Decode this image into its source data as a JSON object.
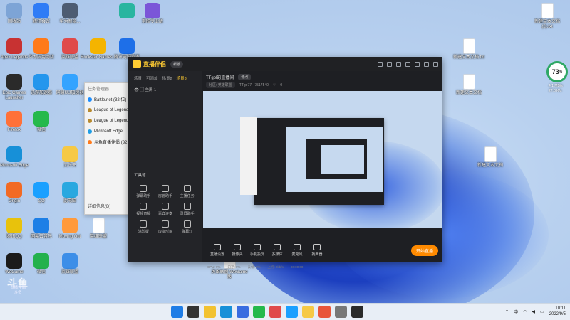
{
  "desktop": {
    "icons": [
      {
        "label": "回收站",
        "color": "#7da4d6",
        "glyph": "recycle-bin"
      },
      {
        "label": "腾讯会议",
        "color": "#2f7cf6",
        "glyph": "meeting"
      },
      {
        "label": "华为智能...",
        "color": "#4d5c72",
        "glyph": "tool"
      },
      {
        "label": "",
        "color": "#29b5a0",
        "glyph": "cloud"
      },
      {
        "label": "剪映专业版",
        "color": "#7b56d8",
        "glyph": "video"
      },
      {
        "label": "Apex Legends",
        "color": "#c83232",
        "glyph": "apex"
      },
      {
        "label": "华为应用商店",
        "color": "#ff7a1a",
        "glyph": "store"
      },
      {
        "label": "英雄联盟",
        "color": "#e04a4a",
        "glyph": "game"
      },
      {
        "label": "Rockstar Games...",
        "color": "#f5b400",
        "glyph": "rockstar"
      },
      {
        "label": "腾讯电脑管家",
        "color": "#1e6fe8",
        "glyph": "shield"
      },
      {
        "label": "Epic Games Launcher",
        "color": "#2a2a2a",
        "glyph": "epic"
      },
      {
        "label": "迅游加速器",
        "color": "#2496ed",
        "glyph": "speed"
      },
      {
        "label": "网易UU加速器",
        "color": "#33a3ff",
        "glyph": "speed"
      },
      {
        "label": "Firefox",
        "color": "#ff7139",
        "glyph": "firefox"
      },
      {
        "label": "微信",
        "color": "#25b94b",
        "glyph": "wechat"
      },
      {
        "label": "Microsoft Edge",
        "color": "#1790d8",
        "glyph": "edge"
      },
      {
        "label": "文件夹",
        "color": "#f6c945",
        "glyph": "folder"
      },
      {
        "label": "Origin",
        "color": "#f26a24",
        "glyph": "origin"
      },
      {
        "label": "QQ",
        "color": "#1aa0ff",
        "glyph": "qq"
      },
      {
        "label": "此电脑",
        "color": "#29a8e0",
        "glyph": "pc"
      },
      {
        "label": "腾讯QQ",
        "color": "#e8c20c",
        "glyph": "qq"
      },
      {
        "label": "网易云音乐",
        "color": "#1d7fe6",
        "glyph": "music"
      },
      {
        "label": "Moving Out",
        "color": "#ff9a3c",
        "glyph": "game"
      },
      {
        "label": "WeGame",
        "color": "#1b1b1b",
        "glyph": "wegame"
      },
      {
        "label": "微信",
        "color": "#23b14d",
        "glyph": "wechat"
      },
      {
        "label": "英雄联盟",
        "color": "#3c8ee8",
        "glyph": "game"
      },
      {
        "label": "英雄联盟",
        "color": "#f4f6f8",
        "glyph": "doc"
      },
      {
        "label": "英雄联盟 WeGame版",
        "color": "#f4f6f8",
        "glyph": "doc"
      },
      {
        "label": "新建文本文档 (2).txt",
        "color": "#ffffff",
        "glyph": "doc"
      },
      {
        "label": "新建文本文档.txt",
        "color": "#ffffff",
        "glyph": "doc"
      },
      {
        "label": "新建文本文档",
        "color": "#ffffff",
        "glyph": "doc"
      },
      {
        "label": "新建文本文档",
        "color": "#ffffff",
        "glyph": "doc"
      }
    ]
  },
  "task_menu": {
    "header": "任务管理器",
    "items": [
      {
        "label": "Battle.net (32 位)",
        "color": "#1a8cff"
      },
      {
        "label": "League of Legends",
        "color": "#b88a2e"
      },
      {
        "label": "League of Legends",
        "color": "#b88a2e"
      },
      {
        "label": "Microsoft Edge",
        "color": "#1e9de4"
      },
      {
        "label": "斗鱼直播伴侣 (32 位)",
        "color": "#ff7a1a"
      }
    ],
    "footer": "详细信息(D)"
  },
  "app": {
    "name": "直播伴侣",
    "version": "新版",
    "tabs": [
      "场景",
      "可添加",
      "场景2",
      "场景3"
    ],
    "scene_name": "全屏 1",
    "tools_title": "工具箱",
    "tools": [
      "弹幕助手",
      "房管助手",
      "主播任务",
      "视频直播",
      "嘉宾连麦",
      "录屏助手",
      "涂鸦板",
      "虚拟形象",
      "弹幕灯"
    ],
    "room_title": "TTgol的直播间",
    "room_edit": "修改",
    "room_category": "分区: 英雄联盟",
    "room_id": "TTgo77 · 7517540",
    "room_fans": "0",
    "bottom_buttons": [
      "直播设置",
      "摄像头",
      "手机投屏",
      "多媒体",
      "麦克风",
      "扬声器"
    ],
    "start_label": "开始直播",
    "status": [
      "CPU: 0%",
      "内存: 0%",
      "丢帧: 0%",
      "上行: 0kb/s",
      "00:00:00"
    ]
  },
  "widget": {
    "meter_value": "73",
    "meter_unit": "%",
    "upload": "4.1 MB/s",
    "download": "27.6 K/s"
  },
  "watermark": {
    "brand": "斗鱼",
    "sub": "直播伴侣",
    "line2": "斗鱼"
  },
  "taskbar": {
    "apps": [
      "start",
      "search",
      "files",
      "edge",
      "store",
      "wechat",
      "game",
      "qq",
      "folder",
      "chrome",
      "settings",
      "obs"
    ],
    "tray_lang": "中",
    "time": "10:11",
    "date": "2022/9/5"
  }
}
